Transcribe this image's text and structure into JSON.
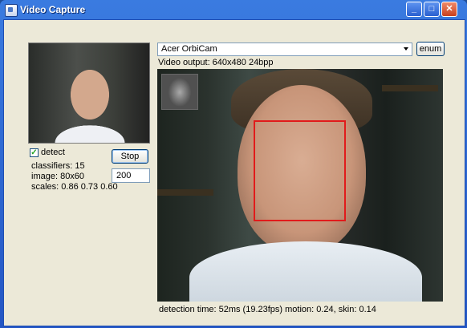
{
  "window": {
    "title": "Video Capture",
    "controls": {
      "minimize": "_",
      "maximize": "□",
      "close": "✕"
    }
  },
  "left_panel": {
    "detect_label": "detect",
    "detect_checked": true,
    "stats": {
      "classifiers": "classifiers: 15",
      "image": "image: 80x60",
      "scales": "scales: 0.86 0.73 0.60"
    },
    "stop_button": "Stop",
    "threshold_value": "200"
  },
  "video_panel": {
    "device": "Acer OrbiCam",
    "enum_button": "enum",
    "output_label": "Video output: 640x480 24bpp",
    "status": "detection time: 52ms (19.23fps)  motion: 0.24, skin: 0.14"
  },
  "colors": {
    "titlebar": "#2a5fd0",
    "face_box": "#e11b1b",
    "client_bg": "#ece9d8"
  },
  "icons": [
    "app-icon",
    "minimize-icon",
    "maximize-icon",
    "close-icon",
    "checkmark-icon",
    "dropdown-arrow-icon"
  ]
}
